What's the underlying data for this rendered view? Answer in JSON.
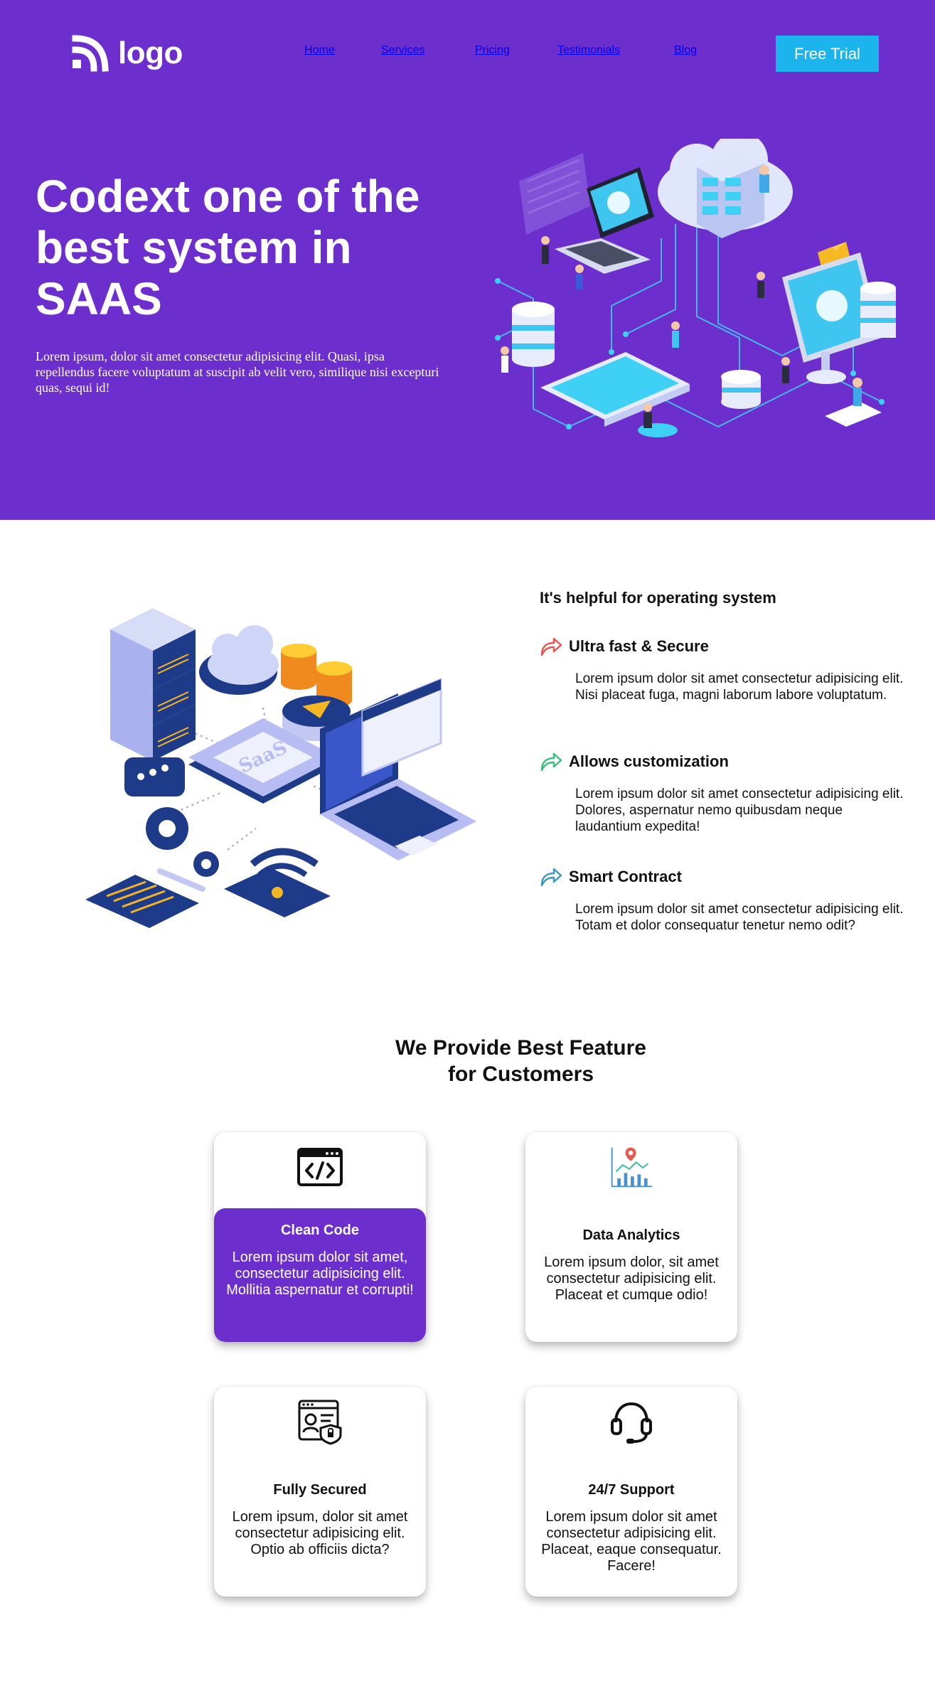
{
  "header": {
    "logo_text": "logo",
    "nav": [
      "Home",
      "Services",
      "Pricing",
      "Testimonials",
      "Blog"
    ],
    "cta_label": "Free Trial"
  },
  "hero": {
    "title": "Codext one of the best system in SAAS",
    "text": "Lorem ipsum, dolor sit amet consectetur adipisicing elit. Quasi, ipsa repellendus facere voluptatum at suscipit ab velit vero, similique nisi excepturi quas, sequi id!",
    "illustration": "isometric-cloud-saas-illustration"
  },
  "helpful": {
    "illustration": "isometric-saas-illustration",
    "illustration_label": "SaaS",
    "heading": "It's helpful for operating system",
    "features": [
      {
        "icon": "share-arrow-icon",
        "color": "#e8574d",
        "title": "Ultra fast & Secure",
        "text": "Lorem ipsum dolor sit amet consectetur adipisicing elit. Nisi placeat fuga, magni laborum labore voluptatum."
      },
      {
        "icon": "share-arrow-icon",
        "color": "#3bc07a",
        "title": "Allows customization",
        "text": "Lorem ipsum dolor sit amet consectetur adipisicing elit. Dolores, aspernatur nemo quibusdam neque laudantium expedita!"
      },
      {
        "icon": "share-arrow-icon",
        "color": "#3a98c9",
        "title": "Smart Contract",
        "text": "Lorem ipsum dolor sit amet consectetur adipisicing elit. Totam et dolor consequatur tenetur nemo odit?"
      }
    ]
  },
  "features": {
    "title_line1": "We Provide Best Feature",
    "title_line2": "for Customers",
    "cards": [
      {
        "icon": "code-window-icon",
        "title": "Clean Code",
        "text": "Lorem ipsum dolor sit amet, consectetur adipisicing elit. Mollitia aspernatur et corrupti!",
        "active": true
      },
      {
        "icon": "analytics-chart-icon",
        "title": "Data Analytics",
        "text": "Lorem ipsum dolor, sit amet consectetur adipisicing elit. Placeat et cumque odio!",
        "active": false
      },
      {
        "icon": "secure-profile-icon",
        "title": "Fully Secured",
        "text": "Lorem ipsum, dolor sit amet consectetur adipisicing elit. Optio ab officiis dicta?",
        "active": false
      },
      {
        "icon": "headset-icon",
        "title": "24/7 Support",
        "text": "Lorem ipsum dolor sit amet consectetur adipisicing elit. Placeat, eaque consequatur. Facere!",
        "active": false
      }
    ]
  },
  "colors": {
    "primary": "#6c2fcd",
    "cta": "#1cb4ec",
    "text": "#111111"
  }
}
